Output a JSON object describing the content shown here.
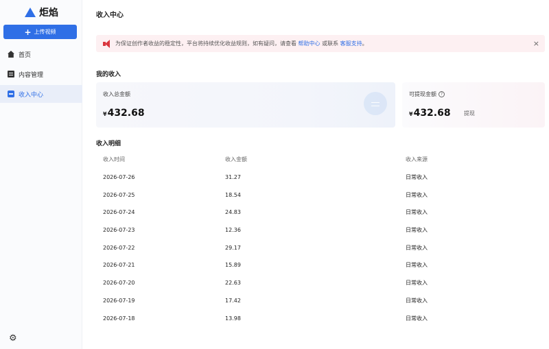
{
  "app": {
    "name": "炬焰",
    "accent": "#2f6fe6"
  },
  "sidebar": {
    "upload_label": "上传视频",
    "items": [
      {
        "label": "首页",
        "icon": "home-icon"
      },
      {
        "label": "内容管理",
        "icon": "content-icon"
      },
      {
        "label": "收入中心",
        "icon": "income-icon",
        "active": true
      }
    ],
    "settings_icon": "gear-icon"
  },
  "page": {
    "title": "收入中心"
  },
  "notice": {
    "text": "为保证创作者收益的稳定性，平台将持续优化收益规则，如有疑问，请查看",
    "link1": "帮助中心",
    "middle": "或联系",
    "link2": "客服支持",
    "end": "。",
    "close": "×"
  },
  "my_income": {
    "heading": "我的收入",
    "total": {
      "label": "收入总金额",
      "currency": "¥",
      "amount": "432.68"
    },
    "available": {
      "label": "可提现金额",
      "currency": "¥",
      "amount": "432.68",
      "withdraw_label": "提现"
    }
  },
  "detail": {
    "heading": "收入明细",
    "columns": [
      "收入时间",
      "收入金额",
      "收入来源"
    ],
    "rows": [
      [
        "2026-07-26",
        "31.27",
        "日常收入"
      ],
      [
        "2026-07-25",
        "18.54",
        "日常收入"
      ],
      [
        "2026-07-24",
        "24.83",
        "日常收入"
      ],
      [
        "2026-07-23",
        "12.36",
        "日常收入"
      ],
      [
        "2026-07-22",
        "29.17",
        "日常收入"
      ],
      [
        "2026-07-21",
        "15.89",
        "日常收入"
      ],
      [
        "2026-07-20",
        "22.63",
        "日常收入"
      ],
      [
        "2026-07-19",
        "17.42",
        "日常收入"
      ],
      [
        "2026-07-18",
        "13.98",
        "日常收入"
      ]
    ]
  }
}
